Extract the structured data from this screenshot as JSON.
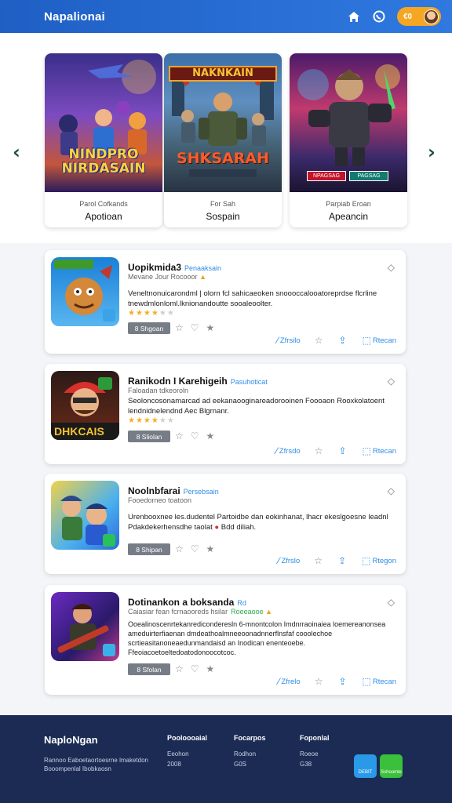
{
  "header": {
    "brand": "Napalionai",
    "coin_label": "€0",
    "icons": [
      "home-icon",
      "phone-icon",
      "coin-icon",
      "avatar"
    ]
  },
  "carousel": {
    "cards": [
      {
        "art_title": "NINDPRO NIRDASAIN",
        "subtitle": "Parol Cofkands",
        "name": "Apotioan"
      },
      {
        "art_title": "SHKSARAH",
        "banner": "NAKNKAIN",
        "subtitle": "For Sah",
        "name": "Sospain"
      },
      {
        "art_title": "",
        "chips": [
          "NPAGSAG",
          "PAGSAG"
        ],
        "subtitle": "Parpiab Eroan",
        "name": "Apeancin"
      }
    ]
  },
  "list": [
    {
      "title": "Uopikmida3",
      "tag": "Penaaksain",
      "meta": "Mevane Jour Rocooor",
      "desc": "Veneltnonuicarondml | olorn fcl sahicaeoken snoooccalooatoreprdse flcrline tnewdmlonloml.lknionandoutte sooaleoolter.",
      "rating": 4,
      "badge": "8 Shgoan",
      "actions": [
        "Zfrsilo",
        "",
        "Rtecan"
      ]
    },
    {
      "title": "Ranikodn I Karehigeih",
      "tag": "Pasuhoticat",
      "meta": "Faloadan tdkeoroln",
      "desc": "Seoloncosonamarcad ad eekanaooginareadorooinen Foooaon Rooxkolatoent lendnidnelendnd Aec Blgrnanr.",
      "rating": 4,
      "badge": "8 Sliolan",
      "actions": [
        "Zfrsdo",
        "",
        "Rtecan"
      ]
    },
    {
      "title": "Noolnbfarai",
      "tag": "Persebsain",
      "meta": "Fooedorneo toatoon",
      "desc": "Urenbooxnee les.dudentel Partoidbe dan eokinhanat, lhacr ekeslgoesne leadnl Pdakdekerhensdhe taolat",
      "desc_tail": "Bdd diliah.",
      "badge": "8 Shipan",
      "actions": [
        "Zfrslo",
        "",
        "Rtegon"
      ]
    },
    {
      "title": "Dotinankon a boksanda",
      "tag": "Rd",
      "meta": "Caiasiar fean fcrnaooreds hsilar",
      "meta_tag": "Roeeaooe",
      "desc": "Ooealinoscenrtekanrediconderesln 6-mnontcolon Imdnrraoinaiea loemereanonsea ameduirterfiaenan dmdeathoalmneeoonadnnerflnsfaf cooolechoe scrtieasitanoneaedunmandaisd an Inodican enenteoebe. Ffeoiacoetoeltedoatodonoocotcoc.",
      "badge": "8 Sfolan",
      "actions": [
        "Zfrelo",
        "",
        "Rtecan"
      ]
    }
  ],
  "footer": {
    "brand": "NaploNgan",
    "about": "Rannoo Eaboetaortoesrne lmaketdon Booompenlal Ibobkaosn",
    "cols": [
      {
        "title": "Pooloooaial",
        "links": [
          "Eeohon",
          "2008"
        ]
      },
      {
        "title": "Focarpos",
        "links": [
          "Rodhon",
          "G0S"
        ]
      },
      {
        "title": "Foponlal",
        "links": [
          "Roeoe",
          "G38"
        ]
      }
    ],
    "stores": [
      "DEBIT",
      "Sshoomle"
    ]
  },
  "colors": {
    "primary": "#2f79e0",
    "footer": "#1b2b54",
    "accent": "#f5a623",
    "link": "#2f8de4"
  }
}
